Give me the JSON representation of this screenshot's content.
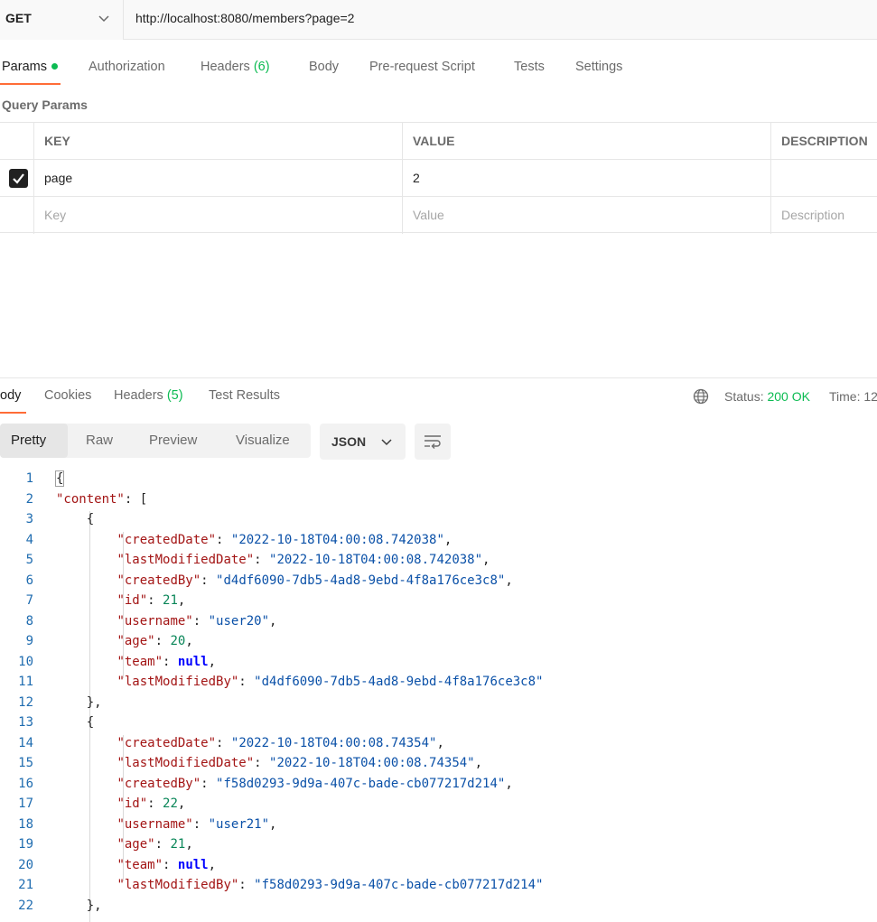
{
  "request": {
    "method": "GET",
    "url": "http://localhost:8080/members?page=2"
  },
  "request_tabs": [
    {
      "label": "Params",
      "count": ""
    },
    {
      "label": "Authorization",
      "count": ""
    },
    {
      "label": "Headers",
      "count": "(6)"
    },
    {
      "label": "Body",
      "count": ""
    },
    {
      "label": "Pre-request Script",
      "count": ""
    },
    {
      "label": "Tests",
      "count": ""
    },
    {
      "label": "Settings",
      "count": ""
    }
  ],
  "query_params": {
    "title": "Query Params",
    "headers": [
      "KEY",
      "VALUE",
      "DESCRIPTION"
    ],
    "rows": [
      {
        "checked": true,
        "key": "page",
        "value": "2",
        "description": ""
      }
    ],
    "placeholders": {
      "key": "Key",
      "value": "Value",
      "description": "Description"
    }
  },
  "response_tabs": [
    {
      "label": "ody",
      "count": ""
    },
    {
      "label": "Cookies",
      "count": ""
    },
    {
      "label": "Headers",
      "count": "(5)"
    },
    {
      "label": "Test Results",
      "count": ""
    }
  ],
  "response_status": {
    "status_label": "Status:",
    "status_value": "200 OK",
    "time_label": "Time:",
    "time_value": "12"
  },
  "view_modes": [
    "Pretty",
    "Raw",
    "Preview",
    "Visualize"
  ],
  "format": "JSON",
  "colors": {
    "accent": "#ff6c37",
    "success": "#0cbb52"
  },
  "code_lines": [
    "{",
    "    \"content\": [",
    "        {",
    "            \"createdDate\": \"2022-10-18T04:00:08.742038\",",
    "            \"lastModifiedDate\": \"2022-10-18T04:00:08.742038\",",
    "            \"createdBy\": \"d4df6090-7db5-4ad8-9ebd-4f8a176ce3c8\",",
    "            \"id\": 21,",
    "            \"username\": \"user20\",",
    "            \"age\": 20,",
    "            \"team\": null,",
    "            \"lastModifiedBy\": \"d4df6090-7db5-4ad8-9ebd-4f8a176ce3c8\"",
    "        },",
    "        {",
    "            \"createdDate\": \"2022-10-18T04:00:08.74354\",",
    "            \"lastModifiedDate\": \"2022-10-18T04:00:08.74354\",",
    "            \"createdBy\": \"f58d0293-9d9a-407c-bade-cb077217d214\",",
    "            \"id\": 22,",
    "            \"username\": \"user21\",",
    "            \"age\": 21,",
    "            \"team\": null,",
    "            \"lastModifiedBy\": \"f58d0293-9d9a-407c-bade-cb077217d214\"",
    "        },"
  ]
}
